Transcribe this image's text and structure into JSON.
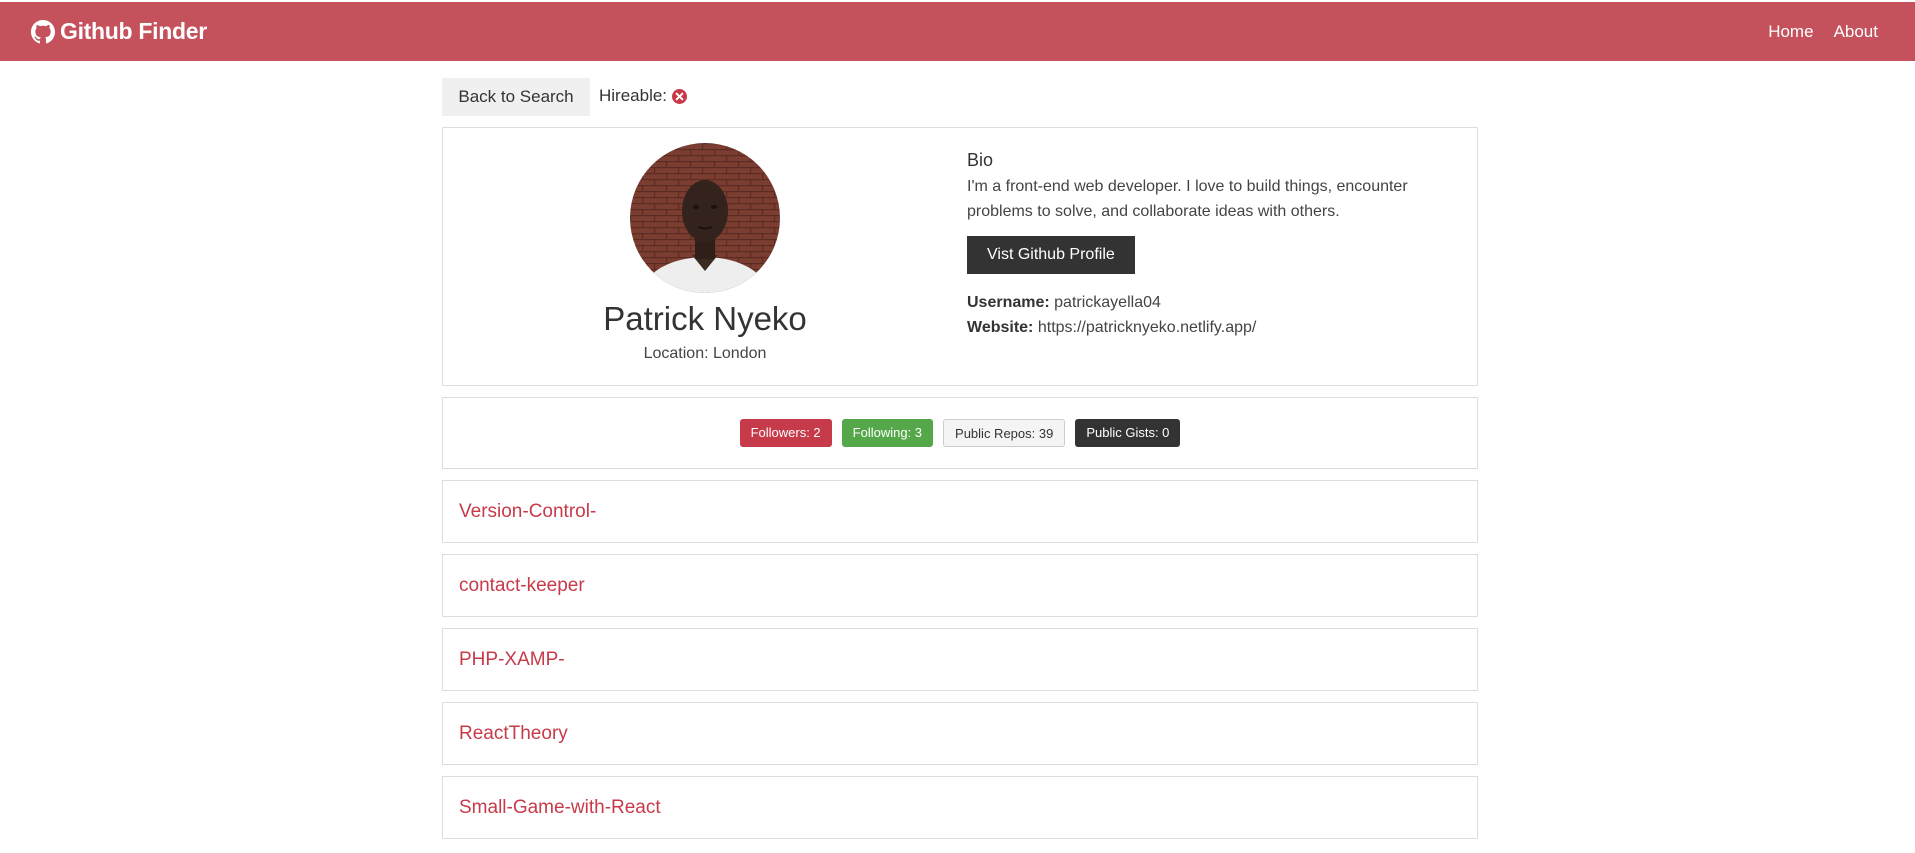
{
  "navbar": {
    "brand": "Github Finder",
    "links": [
      "Home",
      "About"
    ],
    "color": "#c4515c"
  },
  "top": {
    "back_label": "Back to Search",
    "hireable_label": "Hireable:",
    "hireable_icon": "times-circle-icon"
  },
  "profile": {
    "name": "Patrick Nyeko",
    "location": "Location: London",
    "bio_title": "Bio",
    "bio": "I'm a front-end web developer. I love to build things, encounter problems to solve, and collaborate ideas with others.",
    "visit_label": "Vist Github Profile",
    "username_label": "Username:",
    "username": "patrickayella04",
    "website_label": "Website:",
    "website": "https://patricknyeko.netlify.app/"
  },
  "stats": [
    {
      "label": "Followers: 2",
      "color": "#c73a4a"
    },
    {
      "label": "Following: 3",
      "color": "#55a84a"
    },
    {
      "label": "Public Repos: 39",
      "color": "#f4f4f4"
    },
    {
      "label": "Public Gists: 0",
      "color": "#333333"
    }
  ],
  "repos": [
    "Version-Control-",
    "contact-keeper",
    "PHP-XAMP-",
    "ReactTheory",
    "Small-Game-with-React"
  ]
}
